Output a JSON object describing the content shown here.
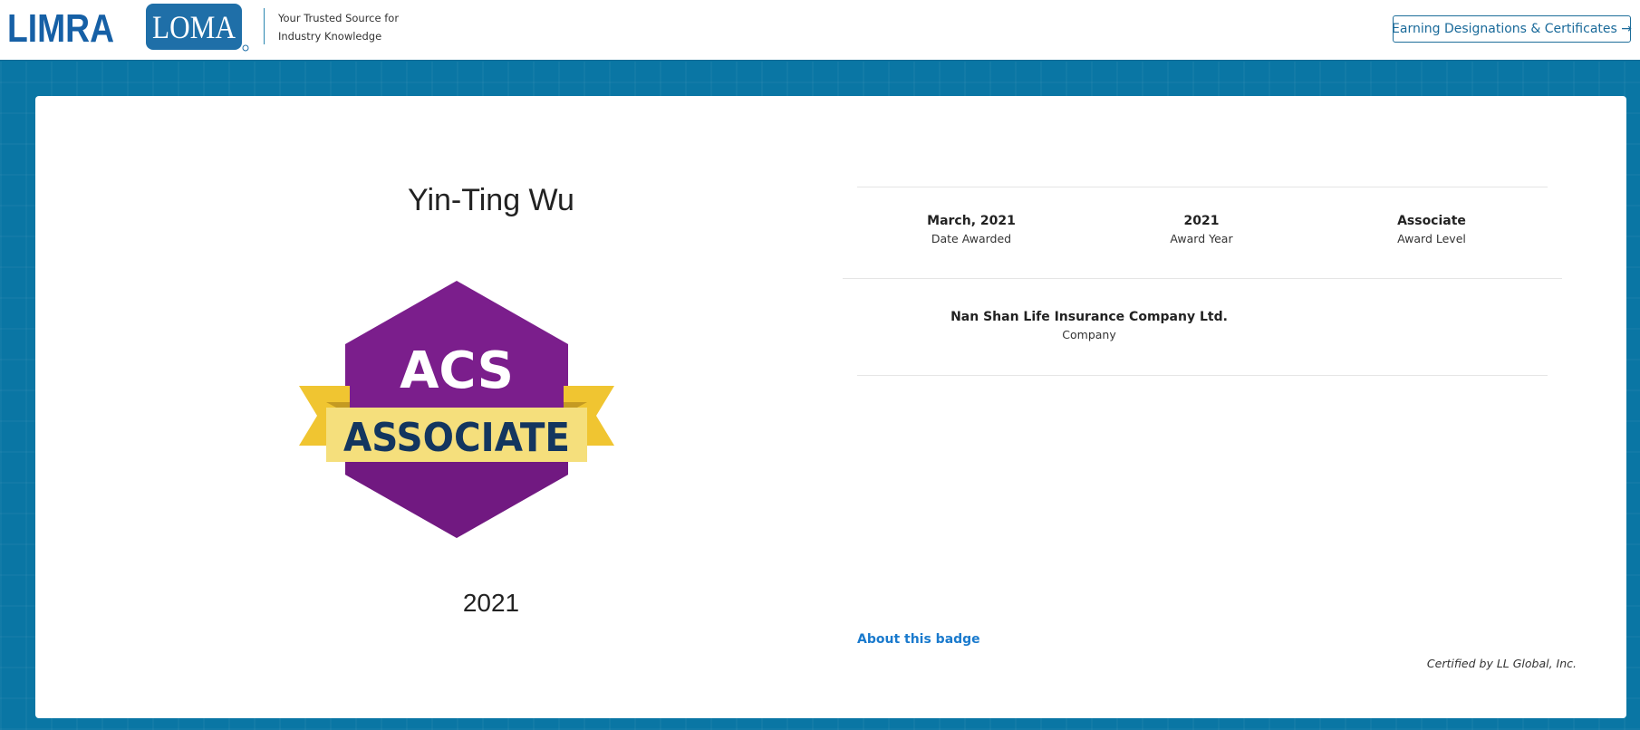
{
  "header": {
    "limra_logo_text": "LIMRA",
    "loma_logo_text": "LOMA",
    "tagline": "Your Trusted Source for Industry Knowledge",
    "earn_button_label": "Earning Designations & Certificates →"
  },
  "badge": {
    "recipient_name": "Yin-Ting Wu",
    "badge_top_text": "ACS",
    "badge_ribbon_text": "ASSOCIATE",
    "year": "2021"
  },
  "details": {
    "date_awarded_value": "March, 2021",
    "date_awarded_label": "Date Awarded",
    "award_year_value": "2021",
    "award_year_label": "Award Year",
    "award_level_value": "Associate",
    "award_level_label": "Award Level",
    "company_value": "Nan Shan Life Insurance Company Ltd.",
    "company_label": "Company"
  },
  "footer": {
    "about_link": "About this badge",
    "certified_by": "Certified by LL Global, Inc."
  },
  "colors": {
    "brand_blue": "#0a76a4",
    "badge_purple": "#7b1e8c",
    "ribbon_yellow": "#f5d03e",
    "ribbon_text_navy": "#13365f",
    "link_blue": "#1a7acd"
  }
}
